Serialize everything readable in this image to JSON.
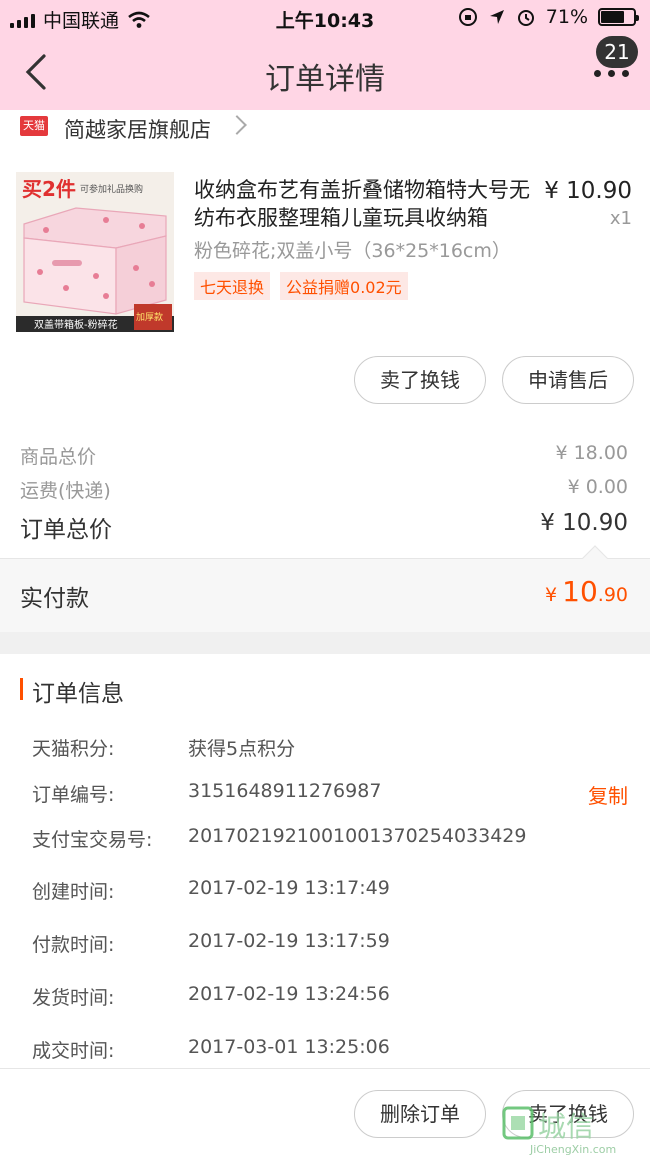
{
  "status_bar": {
    "carrier": "中国联通",
    "time": "上午10:43",
    "battery": "71%",
    "battery_level": 0.71
  },
  "nav": {
    "title": "订单详情",
    "badge_count": "21"
  },
  "shop": {
    "badge": "天猫",
    "name": "简越家居旗舰店"
  },
  "product": {
    "title": "收纳盒布艺有盖折叠储物箱特大号无纺布衣服整理箱儿童玩具收纳箱",
    "price": "¥ 10.90",
    "quantity": "x1",
    "spec": "粉色碎花;双盖小号（36*25*16cm）",
    "tags": [
      "七天退换",
      "公益捐赠0.02元"
    ],
    "image_text": {
      "promo_big": "买2件",
      "promo_small": "可参加礼品换购",
      "bottom_left": "双盖带箱板-粉碎花",
      "bottom_right": "加厚款"
    }
  },
  "item_actions": {
    "sell_label": "卖了换钱",
    "after_sale_label": "申请售后"
  },
  "summary": {
    "goods_total_label": "商品总价",
    "goods_total": "¥ 18.00",
    "shipping_label": "运费(快递)",
    "shipping": "¥ 0.00",
    "order_total_label": "订单总价",
    "order_total": "¥ 10.90"
  },
  "paid": {
    "label": "实付款",
    "currency": "¥",
    "integer": "10",
    "decimal": ".90"
  },
  "order_info": {
    "title": "订单信息",
    "rows": [
      {
        "key": "天猫积分:",
        "value": "获得5点积分"
      },
      {
        "key": "订单编号:",
        "value": "3151648911276987"
      },
      {
        "key": "支付宝交易号:",
        "value": "2017021921001001370254033429"
      },
      {
        "key": "创建时间:",
        "value": "2017-02-19 13:17:49"
      },
      {
        "key": "付款时间:",
        "value": "2017-02-19 13:17:59"
      },
      {
        "key": "发货时间:",
        "value": "2017-02-19 13:24:56"
      },
      {
        "key": "成交时间:",
        "value": "2017-03-01 13:25:06"
      }
    ],
    "copy_label": "复制"
  },
  "bottom_actions": {
    "delete_label": "删除订单",
    "sell_label": "卖了换钱"
  },
  "watermark": {
    "text": "城信",
    "url": "JiChengXin.com"
  },
  "colors": {
    "accent": "#ff5000",
    "header_bg": "#ffd6e5"
  }
}
